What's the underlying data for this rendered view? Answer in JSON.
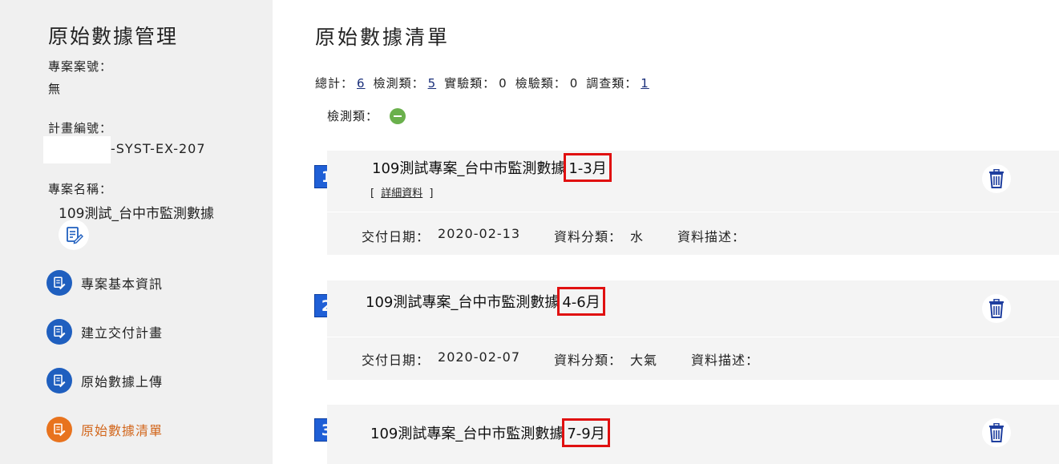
{
  "sidebar": {
    "title": "原始數據管理",
    "case_no_label": "專案案號：",
    "case_no_value": "無",
    "plan_no_label": "計畫編號：",
    "plan_no_value": "-SYST-EX-207",
    "project_name_label": "專案名稱：",
    "project_name_value": "109測試_台中市監測數據",
    "edit_icon": "edit-document-icon",
    "nav": [
      {
        "label": "專案基本資訊",
        "icon": "edit-document-icon",
        "color": "#1f5fbf",
        "active": false
      },
      {
        "label": "建立交付計畫",
        "icon": "edit-document-icon",
        "color": "#1f5fbf",
        "active": false
      },
      {
        "label": "原始數據上傳",
        "icon": "edit-document-icon",
        "color": "#1f5fbf",
        "active": false
      },
      {
        "label": "原始數據清單",
        "icon": "edit-document-icon",
        "color": "#e8731e",
        "active": true
      }
    ]
  },
  "main": {
    "title": "原始數據清單",
    "summary": {
      "total_label": "總計：",
      "total": "6",
      "detect_label": "檢測類：",
      "detect": "5",
      "experiment_label": "實驗類：",
      "experiment": "0",
      "inspect_label": "檢驗類：",
      "inspect": "0",
      "survey_label": "調查類：",
      "survey": "1"
    },
    "category_label": "檢測類：",
    "collapse_icon": "minus-circle-icon",
    "records": [
      {
        "index": "1",
        "title_prefix": "109測試專案_台中市監測數據",
        "title_period": "1-3月",
        "detail_open": "[",
        "detail_link": "詳細資料",
        "detail_close": "]",
        "date_label": "交付日期：",
        "date": "2020-02-13",
        "type_label": "資料分類：",
        "type": "水",
        "desc_label": "資料描述：",
        "desc": ""
      },
      {
        "index": "2",
        "title_prefix": "109測試專案_台中市監測數據",
        "title_period": "4-6月",
        "date_label": "交付日期：",
        "date": "2020-02-07",
        "type_label": "資料分類：",
        "type": "大氣",
        "desc_label": "資料描述：",
        "desc": ""
      },
      {
        "index": "3",
        "title_prefix": "109測試專案_台中市監測數據",
        "title_period": "7-9月"
      }
    ],
    "trash_icon": "trash-icon",
    "highlight_color": "#e01010",
    "badge_color": "#1f5fd6"
  }
}
